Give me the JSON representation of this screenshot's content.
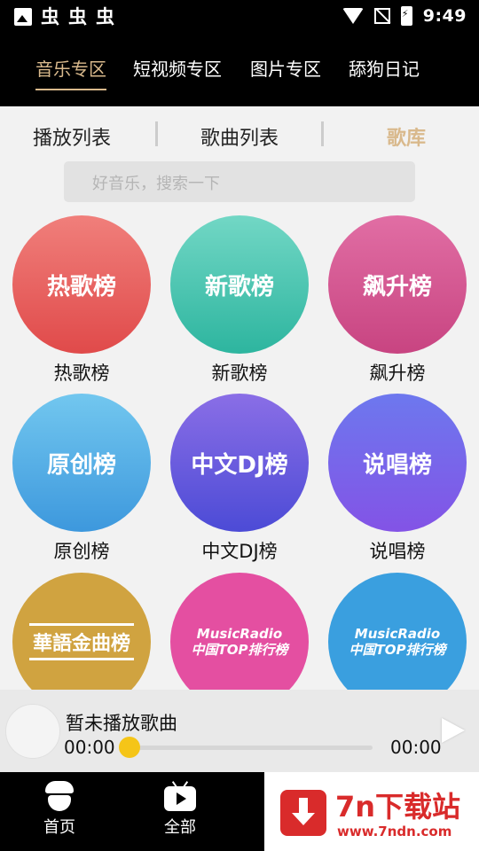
{
  "status_bar": {
    "app_icons": [
      "虫",
      "虫",
      "虫"
    ],
    "time": "9:49"
  },
  "top_tabs": [
    {
      "label": "音乐专区",
      "active": true
    },
    {
      "label": "短视频专区",
      "active": false
    },
    {
      "label": "图片专区",
      "active": false
    },
    {
      "label": "舔狗日记",
      "active": false
    }
  ],
  "sub_tabs": [
    {
      "label": "播放列表",
      "active": false
    },
    {
      "label": "歌曲列表",
      "active": false
    },
    {
      "label": "歌库",
      "active": true
    }
  ],
  "search": {
    "placeholder": "好音乐，搜索一下"
  },
  "charts": [
    {
      "cover_text": "热歌榜",
      "label": "热歌榜"
    },
    {
      "cover_text": "新歌榜",
      "label": "新歌榜"
    },
    {
      "cover_text": "飙升榜",
      "label": "飙升榜"
    },
    {
      "cover_text": "原创榜",
      "label": "原创榜"
    },
    {
      "cover_text": "中文DJ榜",
      "label": "中文DJ榜"
    },
    {
      "cover_text": "说唱榜",
      "label": "说唱榜"
    },
    {
      "cover_text": "華語金曲榜",
      "label": ""
    },
    {
      "cover_text_line1": "MusicRadio",
      "cover_text_line2": "中国TOP排行榜",
      "label": ""
    },
    {
      "cover_text_line1": "MusicRadio",
      "cover_text_line2": "中国TOP排行榜",
      "label": ""
    }
  ],
  "player": {
    "song_title": "暂未播放歌曲",
    "current_time": "00:00",
    "total_time": "00:00",
    "progress": 0
  },
  "bottom_nav": [
    {
      "label": "首页",
      "icon": "acorn-icon"
    },
    {
      "label": "全部",
      "icon": "tv-play-icon"
    }
  ],
  "watermark": {
    "title": "7n下载站",
    "url": "www.7ndn.com"
  },
  "colors": {
    "accent": "#d9b98c",
    "progress_knob": "#f5c518",
    "watermark_red": "#d92b2b"
  }
}
